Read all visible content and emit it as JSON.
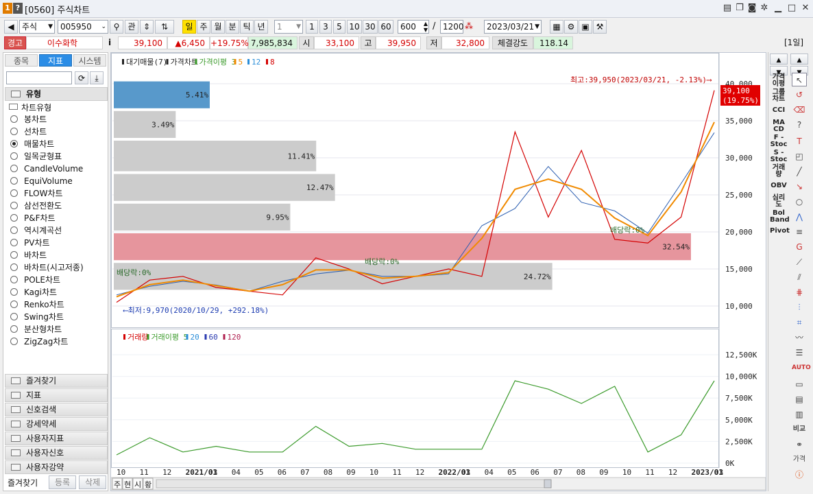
{
  "window": {
    "id": "[0560]",
    "title": "주식차트"
  },
  "toolbar": {
    "market": "주식",
    "code": "005950",
    "search_btn": "관",
    "periods": [
      "일",
      "주",
      "월",
      "분",
      "틱",
      "년"
    ],
    "active_period": "일",
    "interval_value": "1",
    "quick_intervals": [
      "1",
      "3",
      "5",
      "10",
      "30",
      "60"
    ],
    "count_value": "600",
    "count_max": "1200",
    "date": "2023/03/21"
  },
  "info": {
    "warning": "경고",
    "name": "이수화학",
    "i_btn": "i",
    "price": "39,100",
    "change": "▲6,450",
    "change_pct": "+19.75%",
    "volume": "7,985,834",
    "open_label": "시",
    "open": "33,100",
    "high_label": "고",
    "high": "39,950",
    "low_label": "저",
    "low": "32,800",
    "strength_label": "체결강도",
    "strength": "118.14",
    "period_badge": "[1일]"
  },
  "left": {
    "tabs": [
      "종목",
      "지표",
      "시스템"
    ],
    "active_tab": "지표",
    "section": "유형",
    "group": "차트유형",
    "chart_types": [
      "봉차트",
      "선차트",
      "매물차트",
      "일목균형표",
      "CandleVolume",
      "EquiVolume",
      "FLOW차트",
      "삼선전환도",
      "P&F차트",
      "역시계곡선",
      "PV차트",
      "바차트",
      "바차트(시고저종)",
      "POLE차트",
      "Kagi차트",
      "Renko차트",
      "Swing차트",
      "분산형차트",
      "ZigZag차트"
    ],
    "selected": "매물차트",
    "accordions": [
      "즐겨찾기",
      "지표",
      "신호검색",
      "강세약세",
      "사용자지표",
      "사용자신호",
      "사용자강약"
    ],
    "footer": [
      "즐겨찾기",
      "등록",
      "삭제"
    ]
  },
  "chart": {
    "legend_top": [
      "대기매물(7)",
      "가격차트",
      "가격이평 3",
      "5",
      "12",
      "8"
    ],
    "legend_bottom": [
      "거래량",
      "거래이평 5",
      "20",
      "60",
      "120"
    ],
    "high_note": "최고:39,950(2023/03/21, -2.13%)",
    "low_note": "최저:9,970(2020/10/29, +292.18%)",
    "dividend_notes": [
      "배당락:0%",
      "배당락:0%",
      "배당락:0%"
    ],
    "price_tag": "39,100",
    "price_tag_pct": "(19.75%)",
    "price_axis": [
      "40,000",
      "35,000",
      "30,000",
      "25,000",
      "20,000",
      "15,000",
      "10,000"
    ],
    "volume_axis": [
      "12,500K",
      "10,000K",
      "7,500K",
      "5,000K",
      "2,500K",
      "0K"
    ],
    "x_axis": [
      "10",
      "11",
      "12",
      "2021/01",
      "03",
      "04",
      "05",
      "06",
      "07",
      "08",
      "09",
      "10",
      "11",
      "12",
      "2022/01",
      "03",
      "04",
      "05",
      "06",
      "07",
      "08",
      "09",
      "10",
      "11",
      "12",
      "2023/01",
      "03"
    ],
    "volume_profile_pct": [
      "5.41%",
      "3.49%",
      "11.41%",
      "12.47%",
      "9.95%",
      "32.54%",
      "24.72%"
    ],
    "bottom_controls": [
      "주",
      "현",
      "시",
      "황"
    ]
  },
  "chart_data": {
    "type": "line",
    "x": [
      "2020/10",
      "2020/12",
      "2021/02",
      "2021/04",
      "2021/06",
      "2021/08",
      "2021/10",
      "2021/12",
      "2022/02",
      "2022/04",
      "2022/06",
      "2022/08",
      "2022/09",
      "2022/10",
      "2022/11",
      "2022/12",
      "2023/01",
      "2023/02",
      "2023/03/21"
    ],
    "values": [
      10500,
      13500,
      14000,
      12500,
      12000,
      11500,
      16500,
      15000,
      13000,
      14000,
      15000,
      14000,
      33500,
      22000,
      31000,
      19000,
      18500,
      22000,
      39100
    ],
    "ylim": [
      9000,
      41000
    ],
    "volume_profile": [
      {
        "range": [
          36500,
          40500
        ],
        "pct": 5.41
      },
      {
        "range": [
          32500,
          36500
        ],
        "pct": 3.49
      },
      {
        "range": [
          28000,
          32500
        ],
        "pct": 11.41
      },
      {
        "range": [
          24000,
          28000
        ],
        "pct": 12.47
      },
      {
        "range": [
          20000,
          24000
        ],
        "pct": 9.95
      },
      {
        "range": [
          16000,
          20000
        ],
        "pct": 32.54
      },
      {
        "range": [
          12000,
          16000
        ],
        "pct": 24.72
      }
    ]
  }
}
